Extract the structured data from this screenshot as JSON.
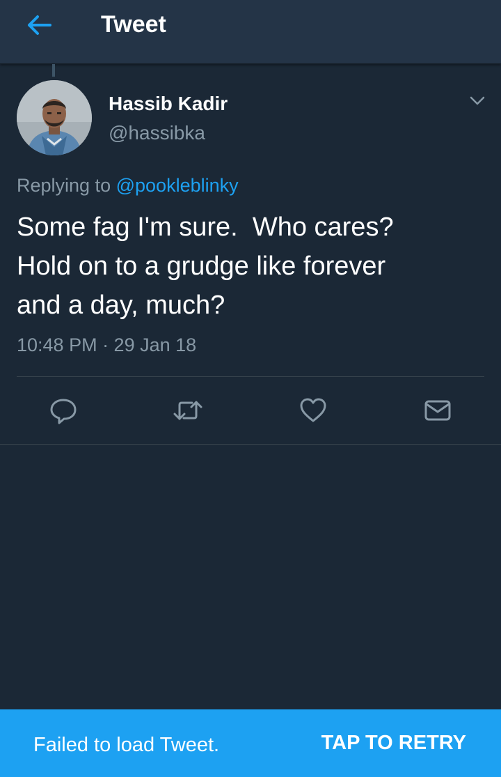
{
  "header": {
    "title": "Tweet",
    "back_icon": "arrow-left-icon",
    "accent_color": "#1da1f2"
  },
  "tweet": {
    "author": {
      "display_name": "Hassib Kadir",
      "handle": "@hassibka",
      "avatar_icon": "user-avatar"
    },
    "replying_prefix": "Replying to",
    "replying_to": "@pookleblinky",
    "text": "Some fag I'm sure.  Who cares?\nHold on to a grudge like forever\nand a day, much?",
    "timestamp": "10:48 PM · 29 Jan 18",
    "menu_icon": "chevron-down-icon"
  },
  "actions": [
    {
      "name": "reply",
      "icon": "reply-icon"
    },
    {
      "name": "retweet",
      "icon": "retweet-icon"
    },
    {
      "name": "like",
      "icon": "heart-icon"
    },
    {
      "name": "share",
      "icon": "mail-icon"
    }
  ],
  "snackbar": {
    "message": "Failed to load Tweet.",
    "action_label": "TAP TO RETRY",
    "background": "#1da1f2"
  },
  "colors": {
    "background": "#1b2836",
    "appbar": "#243447",
    "secondary_text": "#8899a6"
  }
}
